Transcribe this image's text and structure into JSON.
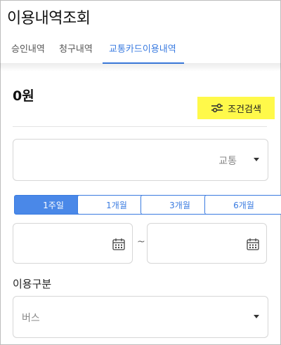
{
  "page": {
    "title": "이용내역조회"
  },
  "tabs": [
    {
      "label": "승인내역",
      "active": false
    },
    {
      "label": "청구내역",
      "active": false
    },
    {
      "label": "교통카드이용내역",
      "active": true
    }
  ],
  "summary": {
    "amount": "0원"
  },
  "filter_button": {
    "label": "조건검색",
    "icon": "sliders-icon",
    "highlight_color": "#fff94a"
  },
  "card_select": {
    "value": "교통"
  },
  "periods": [
    {
      "label": "1주일",
      "active": true
    },
    {
      "label": "1개월",
      "active": false
    },
    {
      "label": "3개월",
      "active": false
    },
    {
      "label": "6개월",
      "active": false
    }
  ],
  "date_range": {
    "start": "",
    "separator": "~",
    "end": "",
    "icon": "calendar-icon"
  },
  "usage_type": {
    "label": "이용구분",
    "value": "버스"
  },
  "colors": {
    "accent": "#3a7be0",
    "active_button": "#4a88e8"
  }
}
